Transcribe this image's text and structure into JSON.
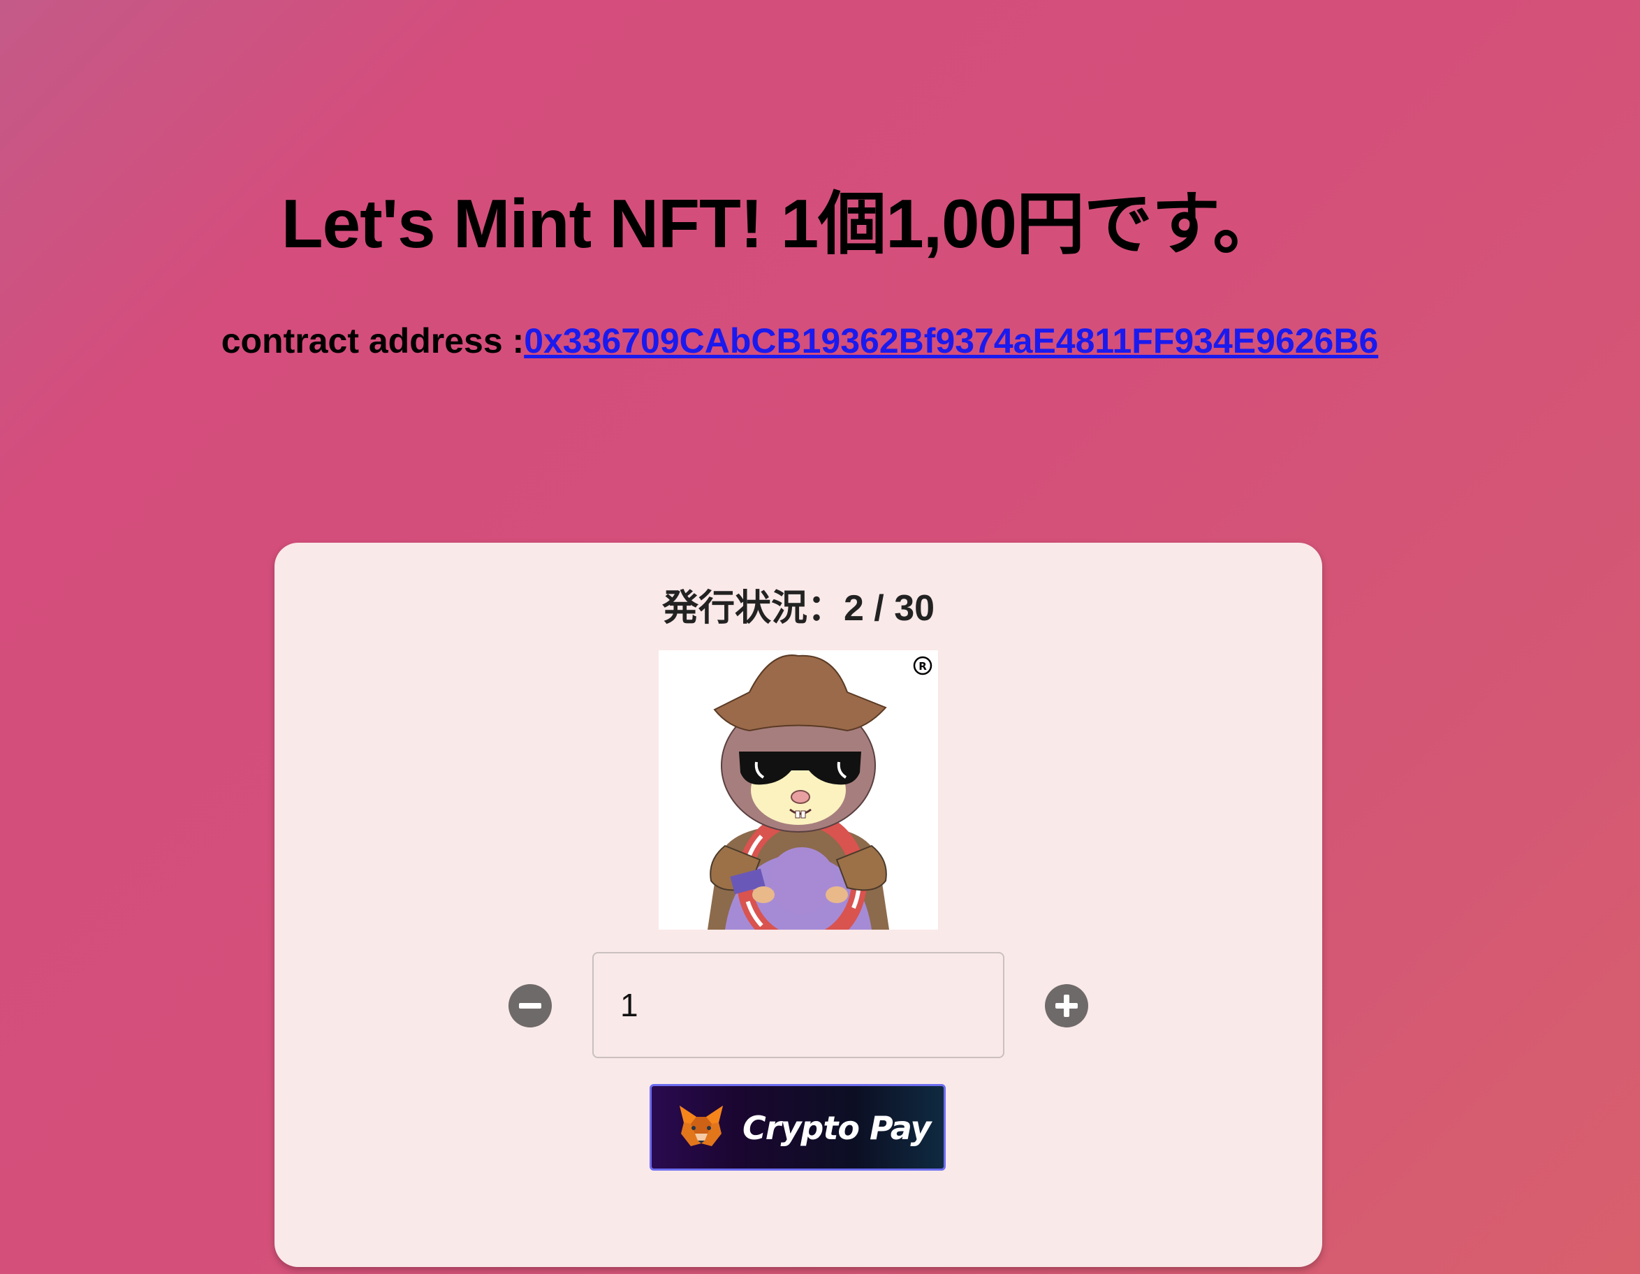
{
  "header": {
    "title": "Let's Mint NFT! 1個1,00円です。",
    "contract_label": "contract address :",
    "contract_address": "0x336709CAbCB19362Bf9374aE4811FF934E9626B6"
  },
  "mint_card": {
    "status_text": "発行状況：2 / 30",
    "minted": 2,
    "total_supply": 30,
    "quantity_value": "1",
    "pay_button_label": "Crypto Pay",
    "icons": {
      "decrement": "minus-circle-icon",
      "increment": "plus-circle-icon",
      "wallet": "metamask-fox-icon"
    }
  },
  "colors": {
    "background_start": "#c45a88",
    "background_end": "#d8606c",
    "card_background": "#f9e9e8",
    "link": "#1a1aee",
    "stepper": "#6f6a6a",
    "pay_button_border": "#6d6df0"
  }
}
